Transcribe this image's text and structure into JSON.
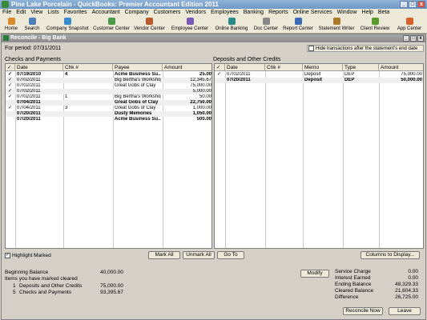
{
  "app": {
    "title": "Pine Lake Porcelain - QuickBooks: Premier Accountant Edition 2011",
    "window_buttons": [
      "_",
      "□",
      "x"
    ]
  },
  "menu": [
    "File",
    "Edit",
    "View",
    "Lists",
    "Favorites",
    "Accountant",
    "Company",
    "Customers",
    "Vendors",
    "Employees",
    "Banking",
    "Reports",
    "Online Services",
    "Window",
    "Help",
    "Beta"
  ],
  "toolbar": [
    {
      "label": "Home",
      "icon": "home-icon",
      "color": "#d98a2b"
    },
    {
      "label": "Search",
      "icon": "search-icon",
      "color": "#4f7fb8"
    },
    {
      "label": "Company Snapshot",
      "icon": "snapshot-icon",
      "color": "#3a8ad0"
    },
    {
      "label": "Customer Center",
      "icon": "customer-icon",
      "color": "#4a9a4a"
    },
    {
      "label": "Vendor Center",
      "icon": "vendor-icon",
      "color": "#b85a2a"
    },
    {
      "label": "Employee Center",
      "icon": "employee-icon",
      "color": "#7a5ab8"
    },
    {
      "label": "Online Banking",
      "icon": "bank-icon",
      "color": "#2a8a8a"
    },
    {
      "label": "Doc Center",
      "icon": "document-icon",
      "color": "#888888"
    },
    {
      "label": "Report Center",
      "icon": "report-icon",
      "color": "#3a6ab8"
    },
    {
      "label": "Statement Writer",
      "icon": "statement-icon",
      "color": "#aa7a2a"
    },
    {
      "label": "Client Review",
      "icon": "review-icon",
      "color": "#5a9a2a"
    },
    {
      "label": "App Center",
      "icon": "app-icon",
      "color": "#d8602a"
    }
  ],
  "reconcile": {
    "title": "Reconcile - Big Bank",
    "period": "For period: 07/31/2011",
    "hide_label": "Hide transactions after the statement's end date",
    "checks_title": "Checks and Payments",
    "deposits_title": "Deposits and Other Credits",
    "checks_headers": {
      "check": "✓",
      "date": "Date",
      "chk": "Chk #",
      "payee": "Payee",
      "amount": "Amount"
    },
    "deposits_headers": {
      "check": "✓",
      "date": "Date",
      "chk": "Chk #",
      "memo": "Memo",
      "type": "Type",
      "amount": "Amount"
    },
    "checks_rows": [
      {
        "mark": "✓",
        "date": "07/19/2010",
        "chk": "4",
        "payee": "Acme Business Su...",
        "amount": "25.00",
        "bold": true
      },
      {
        "mark": "✓",
        "date": "07/02/2011",
        "chk": "",
        "payee": "Big Bertha's Workshop",
        "amount": "12,345.67",
        "bold": false
      },
      {
        "mark": "✓",
        "date": "07/02/2011",
        "chk": "",
        "payee": "Great Gobs of Clay",
        "amount": "75,000.00",
        "bold": false
      },
      {
        "mark": "✓",
        "date": "07/02/2011",
        "chk": "",
        "payee": "",
        "amount": "5,000.00",
        "bold": false
      },
      {
        "mark": "✓",
        "date": "07/02/2011",
        "chk": "1",
        "payee": "Big Bertha's Workshop",
        "amount": "50.00",
        "bold": false
      },
      {
        "mark": "",
        "date": "07/04/2011",
        "chk": "",
        "payee": "Great Gobs of Clay",
        "amount": "22,750.00",
        "bold": true
      },
      {
        "mark": "✓",
        "date": "07/04/2011",
        "chk": "3",
        "payee": "Great Gobs of Clay",
        "amount": "1,000.00",
        "bold": false
      },
      {
        "mark": "",
        "date": "07/20/2011",
        "chk": "",
        "payee": "Dusty Memories",
        "amount": "1,050.00",
        "bold": true
      },
      {
        "mark": "",
        "date": "07/20/2011",
        "chk": "",
        "payee": "Acme Business Su...",
        "amount": "500.00",
        "bold": true
      }
    ],
    "deposits_rows": [
      {
        "mark": "✓",
        "date": "07/02/2011",
        "chk": "",
        "memo": "Deposit",
        "type": "DEP",
        "amount": "75,000.00",
        "bold": false
      },
      {
        "mark": "",
        "date": "07/20/2011",
        "chk": "",
        "memo": "Deposit",
        "type": "DEP",
        "amount": "50,000.00",
        "bold": true
      }
    ],
    "highlight_label": "Highlight Marked",
    "buttons": {
      "mark_all": "Mark All",
      "unmark_all": "Unmark All",
      "go_to": "Go To",
      "columns": "Columns to Display...",
      "modify": "Modify",
      "reconcile_now": "Reconcile Now",
      "leave": "Leave"
    },
    "summary_left": {
      "beginning_balance_label": "Beginning Balance",
      "beginning_balance": "40,000.00",
      "items_label": "Items you have marked cleared",
      "deposits_count": "1",
      "deposits_label": "Deposits and Other Credits",
      "deposits_total": "75,000.00",
      "checks_count": "5",
      "checks_label": "Checks and Payments",
      "checks_total": "93,395.67"
    },
    "summary_right": [
      {
        "label": "Service Charge",
        "value": "0.00"
      },
      {
        "label": "Interest Earned",
        "value": "0.00"
      },
      {
        "label": "Ending Balance",
        "value": "48,329.33"
      },
      {
        "label": "Cleared Balance",
        "value": "21,604.33"
      },
      {
        "label": "Difference",
        "value": "26,725.00"
      }
    ]
  }
}
